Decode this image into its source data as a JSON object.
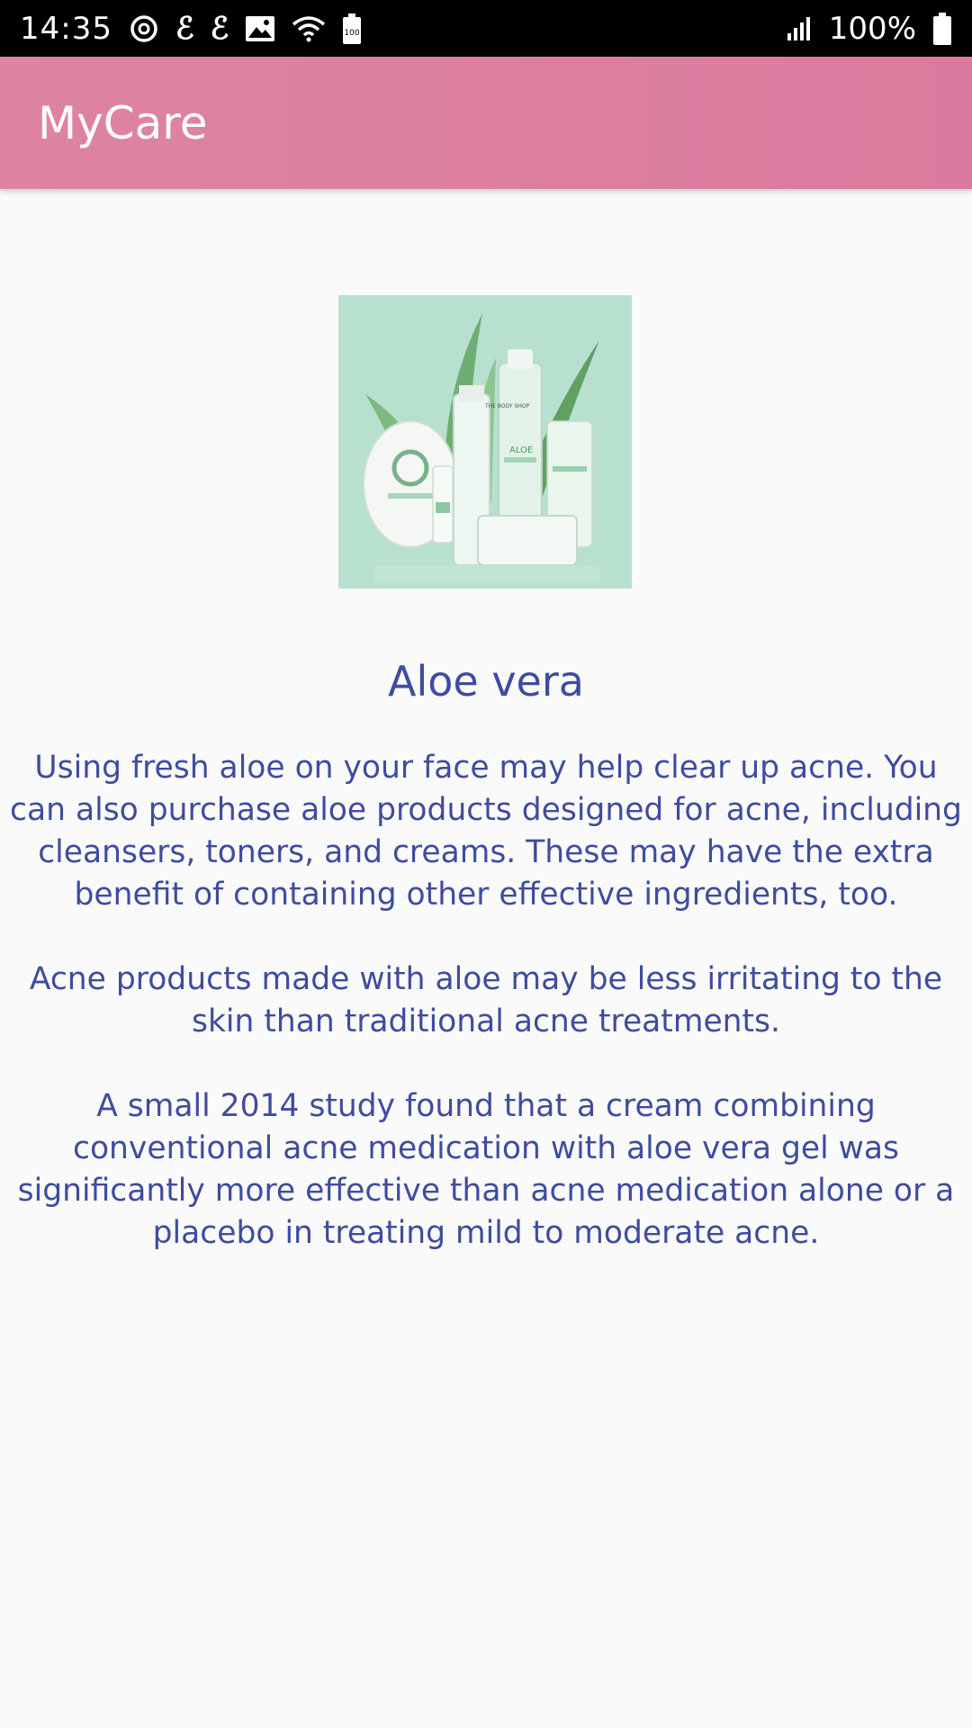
{
  "status_bar": {
    "time": "14:35",
    "left_icons": [
      "sync-icon",
      "e-icon",
      "e-icon",
      "image-icon",
      "wifi-icon",
      "battery-saver-icon"
    ],
    "battery_saver_label": "100",
    "e_glyph": "ℰ",
    "battery_percent": "100%"
  },
  "app_bar": {
    "title": "MyCare"
  },
  "article": {
    "image_alt": "Aloe products",
    "image_brand_lines": [
      "THE BODY SHOP",
      "ALOE"
    ],
    "title": "Aloe vera",
    "paragraphs": [
      "Using fresh aloe on your face may help clear up acne. You can also purchase aloe products designed for acne, including cleansers, toners, and creams. These may have the extra benefit of containing other effective ingredients, too.",
      "Acne products made with aloe may be less irritating to the skin than traditional acne treatments.",
      "A small 2014 study found that a cream combining conventional acne medication with aloe vera gel was significantly more effective than acne medication alone or a placebo in treating mild to moderate acne."
    ]
  },
  "colors": {
    "app_bar": "#dd82a2",
    "text_accent": "#3f4c9e",
    "background": "#fafafa",
    "image_background": "#b8e0cf"
  }
}
